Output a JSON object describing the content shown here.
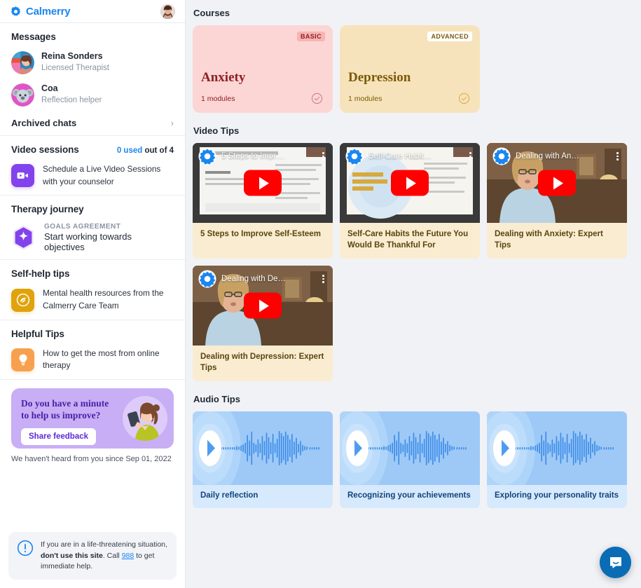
{
  "brand": {
    "name": "Calmerry",
    "color": "#1a86f0",
    "logo_icon": "flower-gear-icon"
  },
  "sidebar": {
    "avatar_name": "user-avatar",
    "messages": {
      "title": "Messages",
      "items": [
        {
          "name": "Reina Sonders",
          "role": "Licensed Therapist",
          "avatar": "therapist-photo-avatar"
        },
        {
          "name": "Coa",
          "role": "Reflection helper",
          "avatar": "koala-avatar"
        }
      ],
      "archived_label": "Archived chats",
      "archived_icon": "chevron-right-icon"
    },
    "video_sessions": {
      "title": "Video sessions",
      "used_count": "0 used",
      "used_suffix": " out of 4",
      "icon": "video-camera-icon",
      "description": "Schedule a Live Video Sessions with your counselor"
    },
    "therapy_journey": {
      "title": "Therapy journey",
      "eyebrow": "GOALS AGREEMENT",
      "icon": "star-hexagon-icon",
      "description": "Start working towards objectives"
    },
    "self_help": {
      "title": "Self-help tips",
      "icon": "leaf-badge-icon",
      "description": "Mental health resources from the Calmerry Care Team"
    },
    "helpful_tips": {
      "title": "Helpful Tips",
      "icon": "lightbulb-icon",
      "description": "How to get the most from online therapy"
    },
    "feedback": {
      "title": "Do you have a minute to help us improve?",
      "button": "Share feedback",
      "note": "We haven't heard from you since Sep 01, 2022",
      "illustration": "woman-with-phone-illustration"
    },
    "crisis": {
      "icon": "exclamation-circle-icon",
      "text_before": "If you are in a life-threatening situation, ",
      "text_bold": "don't use this site",
      "text_mid": ". Call ",
      "link": "988",
      "text_after": " to get immediate help."
    }
  },
  "main": {
    "courses": {
      "title": "Courses",
      "items": [
        {
          "name": "Anxiety",
          "badge": "BASIC",
          "modules": "1 modules",
          "bg": "#fbd6d5",
          "text_color": "#8f1f25",
          "badge_bg": "#f7b4b3",
          "badge_color": "#8f1f25",
          "check_icon": "check-circle-icon"
        },
        {
          "name": "Depression",
          "badge": "ADVANCED",
          "modules": "1 modules",
          "bg": "#f7e3bb",
          "text_color": "#7a5a08",
          "badge_bg": "#ffffff",
          "badge_color": "#7a5a08",
          "check_icon": "check-circle-icon"
        }
      ]
    },
    "video_tips": {
      "title": "Video Tips",
      "items": [
        {
          "caption": "5 Steps to Improve Self-Esteem",
          "overlay_title": "5 Steps to Impr…",
          "scene": "slide-deck",
          "play_icon": "youtube-play-icon",
          "menu_icon": "kebab-menu-icon",
          "channel_icon": "calmerry-channel-icon"
        },
        {
          "caption": "Self-Care Habits the Future You Would Be Thankful For",
          "overlay_title": "Self-Care Habit…",
          "scene": "book-slide",
          "play_icon": "youtube-play-icon",
          "menu_icon": "kebab-menu-icon",
          "channel_icon": "calmerry-channel-icon"
        },
        {
          "caption": "Dealing with Anxiety: Expert Tips",
          "overlay_title": "Dealing with An…",
          "scene": "interview",
          "play_icon": "youtube-play-icon",
          "menu_icon": "kebab-menu-icon",
          "channel_icon": "calmerry-channel-icon"
        },
        {
          "caption": "Dealing with Depression: Expert Tips",
          "overlay_title": "Dealing with De…",
          "scene": "interview",
          "play_icon": "youtube-play-icon",
          "menu_icon": "kebab-menu-icon",
          "channel_icon": "calmerry-channel-icon"
        }
      ]
    },
    "audio_tips": {
      "title": "Audio Tips",
      "items": [
        {
          "caption": "Daily reflection",
          "play_icon": "play-circle-icon",
          "wave_icon": "waveform-icon"
        },
        {
          "caption": "Recognizing your achievements",
          "play_icon": "play-circle-icon",
          "wave_icon": "waveform-icon"
        },
        {
          "caption": "Exploring your personality traits",
          "play_icon": "play-circle-icon",
          "wave_icon": "waveform-icon"
        }
      ]
    }
  },
  "chat_widget": {
    "icon": "chat-bubble-icon",
    "color": "#0a6cb5"
  }
}
